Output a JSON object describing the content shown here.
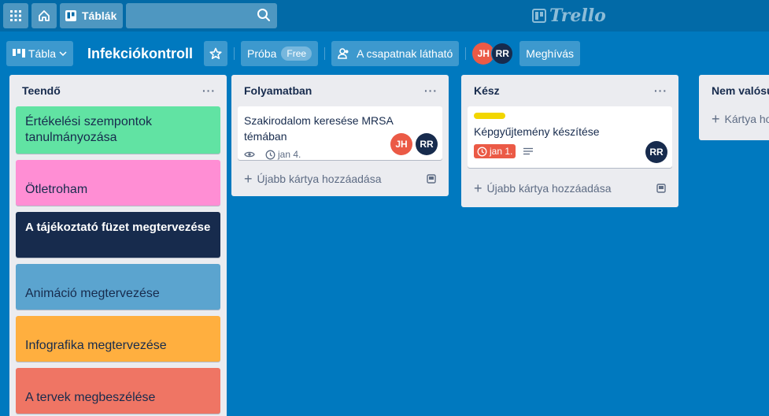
{
  "header": {
    "boards_label": "Táblák",
    "logo_text": "Trello"
  },
  "board": {
    "view_label": "Tábla",
    "title": "Infekciókontroll",
    "workspace_label": "Próba",
    "free_badge": "Free",
    "visibility_label": "A csapatnak látható",
    "members": [
      {
        "initials": "JH",
        "color": "#eb5a46"
      },
      {
        "initials": "RR",
        "color": "#172b4d"
      }
    ],
    "invite_label": "Meghívás"
  },
  "lists": [
    {
      "title": "Teendő",
      "cards": [
        {
          "title": "Értékelési szempontok tanulmányozása",
          "cover": "#61e3a3"
        },
        {
          "title": "Ötletroham",
          "cover": "#ff8ed4"
        },
        {
          "title": "A tájékoztató füzet megtervezése",
          "cover": "#172b4d"
        },
        {
          "title": "Animáció megtervezése",
          "cover": "#5ba4cf"
        },
        {
          "title": "Infografika megtervezése",
          "cover": "#ffaf3f"
        },
        {
          "title": "A tervek megbeszélése",
          "cover": "#ef7564"
        }
      ]
    },
    {
      "title": "Folyamatban",
      "cards": [
        {
          "title": "Szakirodalom keresése MRSA témában",
          "due": "jan 4.",
          "members": [
            "JH",
            "RR"
          ]
        }
      ],
      "add_label": "Újabb kártya hozzáadása"
    },
    {
      "title": "Kész",
      "cards": [
        {
          "title": "Képgyűjtemény készítése",
          "label_color": "#f2d600",
          "due": "jan 1.",
          "members": [
            "RR"
          ]
        }
      ],
      "add_label": "Újabb kártya hozzáadása"
    },
    {
      "title": "Nem valósul meg",
      "add_label": "Kártya hozzáadása"
    }
  ],
  "colors": {
    "board_bg": "#0079bf",
    "header_bg": "#026aa7",
    "list_bg": "#ebecf0"
  }
}
